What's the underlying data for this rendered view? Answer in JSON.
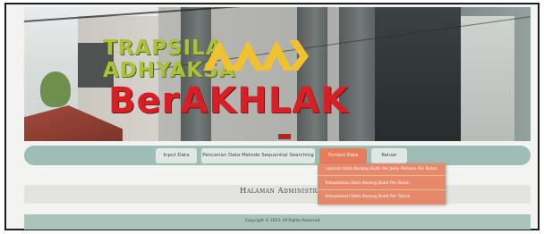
{
  "banner": {
    "logo_line1": "TRAPSILA",
    "logo_line2": "ADHYAKSA",
    "brand_word": "BerAKHLAK"
  },
  "nav": {
    "items": [
      {
        "label": "Input Data"
      },
      {
        "label": "Pencarian Data Metode Sequential Searching"
      },
      {
        "label": "Output Data"
      },
      {
        "label": "Keluar"
      }
    ],
    "active_index": 2
  },
  "dropdown": {
    "items": [
      {
        "label": "Laporan Data Barang Bukti Per Jenis Perkara Per Bulan"
      },
      {
        "label": "Rekapitulasi Data Barang Bukti Per Bulan"
      },
      {
        "label": "Rekapitulasi Data Barang Bukti Per Tahun"
      }
    ]
  },
  "page": {
    "title": "Halaman Administrator"
  },
  "footer": {
    "copyright": "Copyright © 2023. All Rights Reserved."
  },
  "colors": {
    "nav_bar": "#9ebdb4",
    "nav_active": "#e87b5c",
    "dropdown_bg": "#e6896b",
    "brand_red": "#d72026",
    "logo_green": "#a9c23a",
    "chevron_yellow": "#f2c12e"
  }
}
